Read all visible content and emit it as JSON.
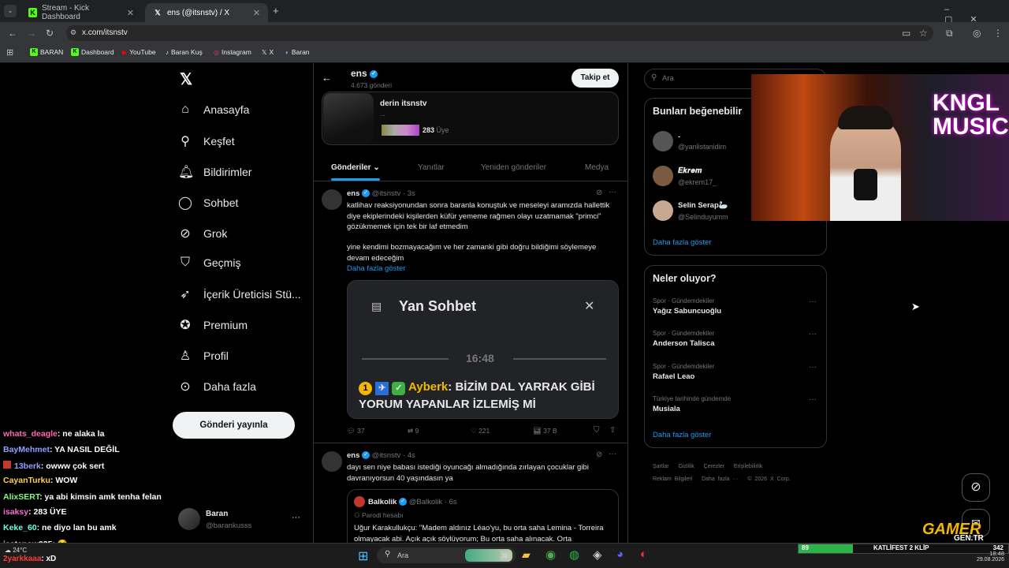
{
  "browser": {
    "tabs": [
      {
        "title": "Stream - Kick Dashboard",
        "active": false
      },
      {
        "title": "ens (@itsnstv) / X",
        "active": true
      }
    ],
    "url": "x.com/itsnstv",
    "bookmarks": [
      "BARAN",
      "Dashboard",
      "YouTube",
      "Baran Kuş",
      "Instagram",
      "X",
      "Baran"
    ]
  },
  "nav": {
    "items": [
      "Anasayfa",
      "Keşfet",
      "Bildirimler",
      "Sohbet",
      "Grok",
      "Geçmiş",
      "İçerik Üreticisi Stü...",
      "Premium",
      "Profil",
      "Daha fazla"
    ],
    "post_button": "Gönderi yayınla",
    "account": {
      "name": "Baran",
      "handle": "@barankusss"
    }
  },
  "profile": {
    "name": "ens",
    "posts": "4.673 gönderi",
    "follow_label": "Takip et",
    "community": {
      "name": "derin itsnstv",
      "ellipsis": "...",
      "members": "283",
      "members_label": "Üye"
    }
  },
  "tabs": [
    "Gönderiler",
    "Yanıtlar",
    "Yeniden gönderiler",
    "Medya"
  ],
  "tweets": [
    {
      "name": "ens",
      "handle": "@itsnstv",
      "time": "3s",
      "text1": "katlihav reaksiyonundan sonra baranla konuştuk ve meseleyi aramızda hallettik diye ekiplerindeki kişilerden küfür yememe rağmen olayı uzatmamak \"primci\" gözükmemek için tek bir laf etmedim",
      "text2": "yine kendimi bozmayacağım ve her zamanki gibi doğru bildiğimi söylemeye devam edeceğim",
      "more": "Daha fazla göster",
      "image": {
        "title": "Yan Sohbet",
        "time": "16:48",
        "badge_num": "1",
        "user": "Ayberk",
        "message": ": BİZİM DAL YARRAK GİBİ YORUM YAPANLAR İZLEMİŞ Mİ"
      },
      "stats": {
        "replies": "37",
        "reposts": "9",
        "likes": "221",
        "views": "37 B"
      }
    },
    {
      "name": "ens",
      "handle": "@itsnstv",
      "time": "4s",
      "text1": "dayı sen niye babası istediği oyuncağı almadığında zırlayan çocuklar gibi davranıyorsun 40 yaşındasın ya",
      "quote": {
        "name": "Balkolik",
        "handle": "@Balkolik",
        "time": "6s",
        "label": "Parodi hesabı",
        "text": "Uğur Karakullukçu: \"Madem aldınız Léao'yu, bu orta saha Lemina - Torreira olmayacak abi. Açık açık söylüyorum; Bu orta saha alınacak. Orta"
      }
    }
  ],
  "right": {
    "search_placeholder": "Ara",
    "who_to_follow": {
      "title": "Bunları beğenebilir",
      "users": [
        {
          "name": "-",
          "handle": "@yanlistanidim"
        },
        {
          "name": "𝑬𝒌𝒓𝒆𝒎",
          "handle": "@ekrem17_"
        },
        {
          "name": "Selin Serap🦢",
          "handle": "@Selinduyumm"
        }
      ],
      "more": "Daha fazla göster"
    },
    "trends": {
      "title": "Neler oluyor?",
      "items": [
        {
          "category": "Spor · Gündemdekiler",
          "name": "Yağız Sabuncuoğlu"
        },
        {
          "category": "Spor · Gündemdekiler",
          "name": "Anderson Talisca"
        },
        {
          "category": "Spor · Gündemdekiler",
          "name": "Rafael Leao"
        },
        {
          "category": "Türkiye tarihinde gündemde",
          "name": "Musiala"
        }
      ],
      "more": "Daha fazla göster"
    },
    "footer": [
      "Şartlar",
      "Gizlilik",
      "Çerezler",
      "Erişilebilirlik",
      "Reklam Bilgileri",
      "Daha fazla ···",
      "© 2026 X Corp."
    ]
  },
  "chat": [
    {
      "user": "whats_deagle",
      "color": "#ff69b4",
      "msg": ": ne alaka la"
    },
    {
      "user": "BayMehmet",
      "color": "#8fa0ff",
      "msg": ": YA NASIL DEĞİL"
    },
    {
      "user": "13berk",
      "color": "#8fa0ff",
      "msg": ": owww çok sert"
    },
    {
      "user": "CayanTurku",
      "color": "#ffd24d",
      "msg": ": WOW"
    },
    {
      "user": "AlixSERT",
      "color": "#7cff7c",
      "msg": ": ya abi kimsin amk tenha felan"
    },
    {
      "user": "isaksy",
      "color": "#ff6bd6",
      "msg": ": 283 ÜYE"
    },
    {
      "user": "Keke_60",
      "color": "#6bffe0",
      "msg": ": ne diyo lan bu amk"
    },
    {
      "user": "jaatenow035",
      "color": "#ffffff",
      "msg": ": 😂"
    },
    {
      "user": "2yarkkaaa",
      "color": "#ff3b3b",
      "msg": ": xD"
    }
  ],
  "overlay": {
    "brand1": "KNGL",
    "brand2": "MUSIC",
    "logo": "GAMER",
    "logo_sub": "GEN.TR",
    "bar_value": "89",
    "bar_text": "KATLİFEST 2 KLİP",
    "bar_count": "342"
  },
  "taskbar": {
    "weather": "24°C",
    "search": "Ara",
    "time": "18:48",
    "date": "29.08.2026"
  }
}
